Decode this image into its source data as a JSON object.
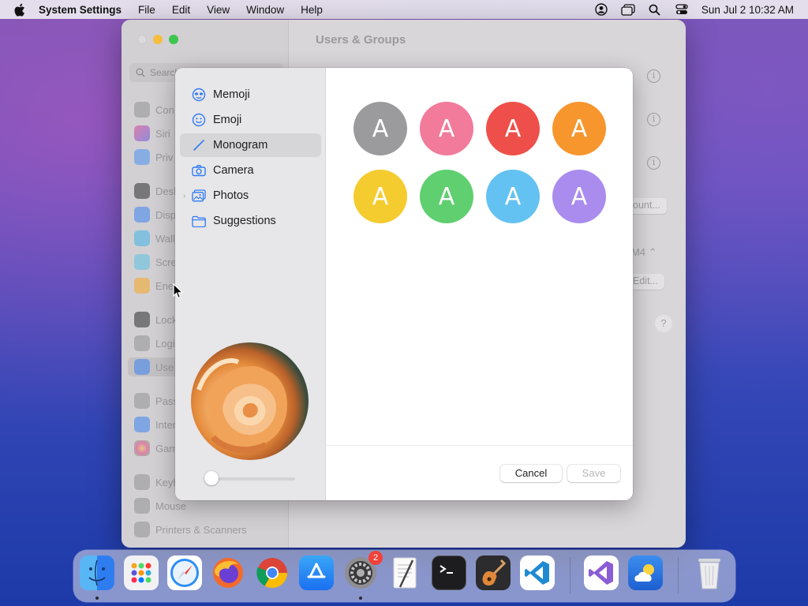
{
  "menubar": {
    "app_name": "System Settings",
    "menus": [
      "File",
      "Edit",
      "View",
      "Window",
      "Help"
    ],
    "clock": "Sun Jul 2  10:32 AM",
    "icons": [
      "apple-icon",
      "user-account-icon",
      "window-icon",
      "search-icon",
      "control-center-icon"
    ]
  },
  "settings": {
    "title": "Users & Groups",
    "search_placeholder": "Search",
    "sidebar": [
      {
        "label": "Con",
        "icon": "gear-icon"
      },
      {
        "label": "Siri",
        "icon": "siri-icon"
      },
      {
        "label": "Priv",
        "icon": "hand-icon"
      },
      {
        "label": "Desk",
        "icon": "desktop-icon"
      },
      {
        "label": "Disp",
        "icon": "sun-icon"
      },
      {
        "label": "Wall",
        "icon": "wallpaper-icon"
      },
      {
        "label": "Scre",
        "icon": "screensaver-icon"
      },
      {
        "label": "Ene",
        "icon": "bulb-icon"
      },
      {
        "label": "Lock",
        "icon": "lock-icon"
      },
      {
        "label": "Logi",
        "icon": "login-icon"
      },
      {
        "label": "Use",
        "icon": "users-icon"
      },
      {
        "label": "Pass",
        "icon": "key-icon"
      },
      {
        "label": "Inter",
        "icon": "at-icon"
      },
      {
        "label": "Gam",
        "icon": "game-center-icon"
      },
      {
        "label": "Keyb",
        "icon": "keyboard-icon"
      },
      {
        "label": "Mouse",
        "icon": "mouse-icon"
      },
      {
        "label": "Printers & Scanners",
        "icon": "printer-icon"
      }
    ],
    "main": {
      "account_button": "ount...",
      "selector_value": "M4",
      "edit_button": "Edit...",
      "help_button": "?",
      "info_glyph": "i"
    }
  },
  "sheet": {
    "sources": [
      {
        "label": "Memoji",
        "icon": "memoji-icon"
      },
      {
        "label": "Emoji",
        "icon": "emoji-icon"
      },
      {
        "label": "Monogram",
        "icon": "pencil-icon",
        "selected": true
      },
      {
        "label": "Camera",
        "icon": "camera-icon"
      },
      {
        "label": "Photos",
        "icon": "photos-icon",
        "expandable": true
      },
      {
        "label": "Suggestions",
        "icon": "folder-icon"
      }
    ],
    "monogram_letter": "A",
    "monogram_colors": [
      "#9b9a9c",
      "#f27a9b",
      "#ef4f4a",
      "#f6962d",
      "#f5cc2f",
      "#5fcf6f",
      "#64c2f2",
      "#a98cee"
    ],
    "zoom_level": 0,
    "cancel_label": "Cancel",
    "save_label": "Save"
  },
  "dock": {
    "apps": [
      {
        "name": "Finder",
        "running": true
      },
      {
        "name": "Launchpad"
      },
      {
        "name": "Safari"
      },
      {
        "name": "Firefox"
      },
      {
        "name": "Chrome"
      },
      {
        "name": "App Store"
      },
      {
        "name": "System Settings",
        "running": true,
        "badge": "2"
      },
      {
        "name": "TextEdit"
      },
      {
        "name": "Terminal"
      },
      {
        "name": "GarageBand"
      },
      {
        "name": "Visual Studio Code"
      },
      {
        "name": "Visual Studio"
      },
      {
        "name": "Weather"
      },
      {
        "name": "Trash"
      }
    ]
  }
}
